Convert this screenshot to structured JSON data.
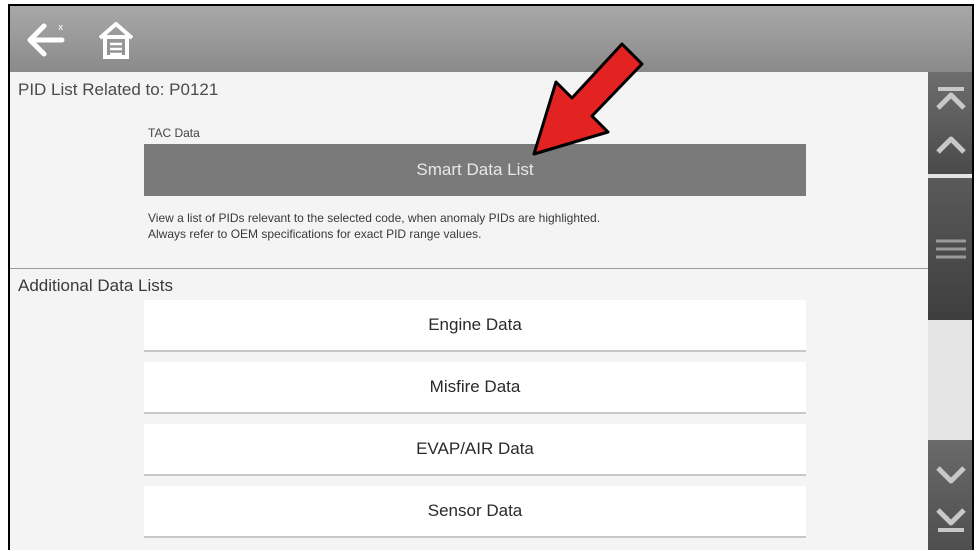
{
  "header": {
    "back_icon": "back-arrow-icon",
    "home_icon": "home-icon"
  },
  "pid_list": {
    "title": "PID List Related to:  P0121",
    "section_label": "TAC Data",
    "smart_button_label": "Smart Data List",
    "description_line1": "View a list of PIDs relevant to the selected code, when anomaly PIDs are highlighted.",
    "description_line2": "Always refer to OEM specifications for exact PID range values."
  },
  "additional": {
    "title": "Additional Data Lists",
    "items": [
      {
        "label": "Engine Data"
      },
      {
        "label": "Misfire Data"
      },
      {
        "label": "EVAP/AIR Data"
      },
      {
        "label": "Sensor Data"
      }
    ]
  },
  "scrollbar": {
    "top_icon": "scroll-top-icon",
    "up_icon": "scroll-up-icon",
    "thumb_icon": "grip-icon",
    "down_icon": "scroll-down-icon",
    "bottom_icon": "scroll-bottom-icon"
  },
  "colors": {
    "topbar": "#9a9a9a",
    "smart_button": "#7a7a7a",
    "annotation_arrow": "#e32222"
  }
}
